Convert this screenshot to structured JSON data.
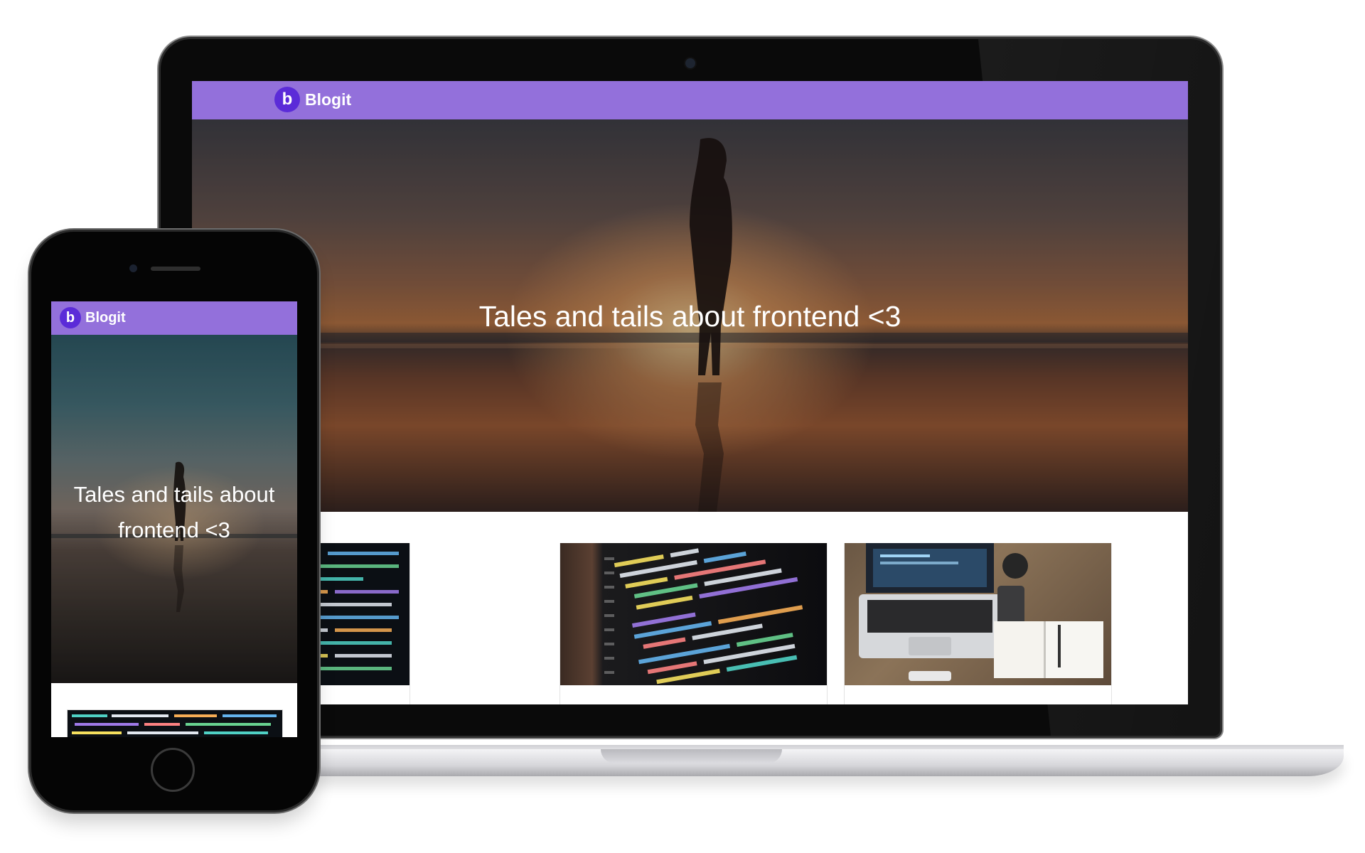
{
  "brand": {
    "logo_letter": "b",
    "name": "Blogit",
    "nav_color": "#9370db"
  },
  "hero": {
    "title": "Tales and tails about frontend <3"
  },
  "posts": [
    {
      "image": "code-colorful-text"
    },
    {
      "image": "python-code-editor"
    },
    {
      "image": "laptop-on-desk"
    }
  ],
  "mobile": {
    "logo_letter": "b",
    "name": "Blogit",
    "hero_title": "Tales and tails about frontend <3"
  }
}
